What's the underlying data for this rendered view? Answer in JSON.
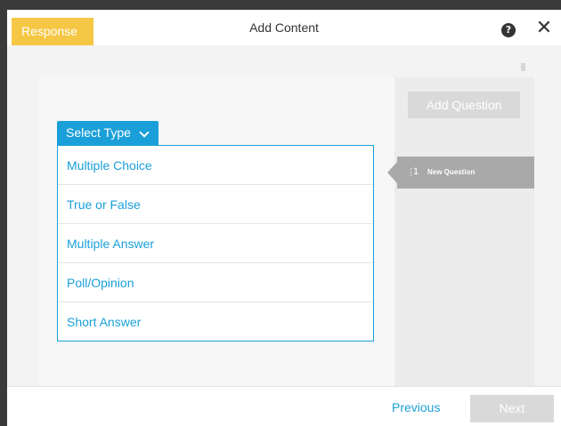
{
  "header": {
    "tag_label": "Response",
    "title": "Add Content",
    "help_icon": "question-circle-icon",
    "close_icon": "close-icon",
    "help_glyph": "?",
    "close_glyph": "✕"
  },
  "select_type": {
    "label": "Select Type",
    "icon": "chevron-down-icon",
    "options": [
      "Multiple Choice",
      "True or False",
      "Multiple Answer",
      "Poll/Opinion",
      "Short Answer"
    ]
  },
  "sidebar": {
    "add_question_label": "Add Question",
    "questions": [
      {
        "number": "1",
        "label": "New Question"
      }
    ]
  },
  "footer": {
    "previous_label": "Previous",
    "next_label": "Next"
  },
  "colors": {
    "accent": "#1a9fd9",
    "tag": "#f5c745",
    "disabled": "#d9d9d9"
  }
}
